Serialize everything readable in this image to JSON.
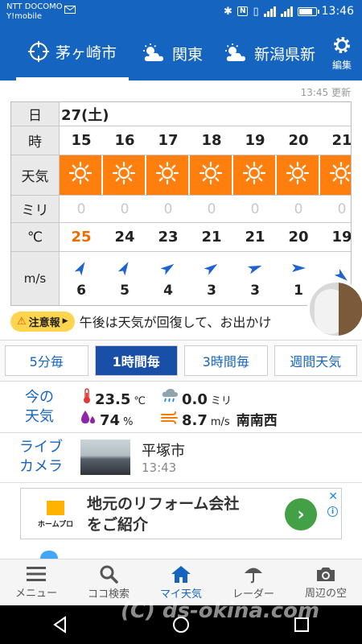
{
  "status_bar": {
    "carrier_line1": "NTT DOCOMO",
    "carrier_line2": "Y!mobile",
    "time": "13:46",
    "icons": [
      "mail-icon",
      "bluetooth-icon",
      "nfc-icon",
      "vibrate-icon",
      "4g-signal-icon",
      "signal-icon",
      "battery-icon"
    ],
    "battery_level": 0.85
  },
  "locations": [
    {
      "label": "茅ヶ崎市",
      "icon": "current-location-icon",
      "active": true
    },
    {
      "label": "関東",
      "icon": "sun-cloud-icon",
      "active": false
    },
    {
      "label": "新潟県新",
      "icon": "sun-cloud-icon",
      "active": false
    }
  ],
  "settings_label": "編集",
  "forecast": {
    "updated": "13:45 更新",
    "labels": {
      "day": "日",
      "hour": "時",
      "weather": "天気",
      "rain": "ミリ",
      "temp": "℃",
      "wind": "m/s"
    },
    "day": "27(土)",
    "hours": [
      "15",
      "16",
      "17",
      "18",
      "19",
      "20",
      "21"
    ],
    "weather": [
      "sunny",
      "sunny",
      "sunny",
      "sunny",
      "sunny",
      "sunny",
      "sunny"
    ],
    "rain": [
      "0",
      "0",
      "0",
      "0",
      "0",
      "0",
      "0"
    ],
    "temps": [
      "25",
      "24",
      "23",
      "21",
      "21",
      "20",
      "19"
    ],
    "wind_speed": [
      "6",
      "5",
      "4",
      "3",
      "3",
      "1",
      ""
    ],
    "wind_dir_deg": [
      30,
      30,
      55,
      55,
      70,
      90,
      130
    ]
  },
  "alert": {
    "badge": "注意報",
    "text": "午後は天気が回復して、お出かけ"
  },
  "segments": [
    {
      "label": "5分毎",
      "active": false
    },
    {
      "label": "1時間毎",
      "active": true
    },
    {
      "label": "3時間毎",
      "active": false
    },
    {
      "label": "週間天気",
      "active": false
    }
  ],
  "current": {
    "label_line1": "今の",
    "label_line2": "天気",
    "temp": "23.5",
    "temp_unit": "℃",
    "rain": "0.0",
    "rain_unit": "ミリ",
    "humidity": "74",
    "humidity_unit": "%",
    "wind": "8.7",
    "wind_unit": "m/s",
    "wind_dir": "南南西"
  },
  "live_camera": {
    "label_line1": "ライブ",
    "label_line2": "カメラ",
    "city": "平塚市",
    "time": "13:43"
  },
  "ad": {
    "logo_text": "ホームプロ",
    "line1": "地元のリフォーム会社",
    "line2": "をご紹介",
    "go": "›",
    "close": "✕",
    "info": "i"
  },
  "bottom_nav": [
    {
      "label": "メニュー",
      "icon": "menu-icon",
      "active": false
    },
    {
      "label": "ココ検索",
      "icon": "search-icon",
      "active": false
    },
    {
      "label": "マイ天気",
      "icon": "home-icon",
      "active": true
    },
    {
      "label": "レーダー",
      "icon": "umbrella-icon",
      "active": false
    },
    {
      "label": "周辺の空",
      "icon": "camera-icon",
      "active": false
    }
  ],
  "watermark": "(C) ds-okina.com",
  "colors": {
    "brand": "#1565c0",
    "sunny_cell": "#ff7f0e",
    "alert_badge": "#ffd54f",
    "ad_button": "#43a047"
  }
}
